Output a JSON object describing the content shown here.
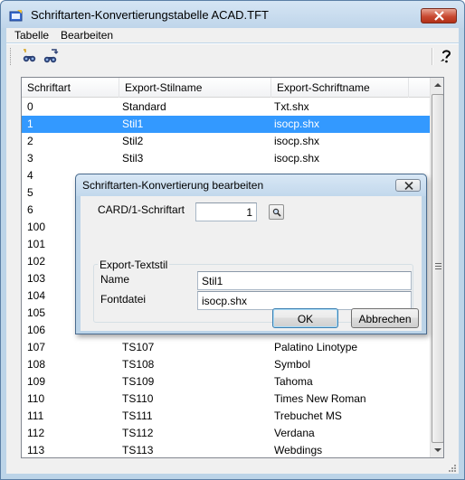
{
  "window": {
    "title": "Schriftarten-Konvertierungstabelle ACAD.TFT",
    "icon": "app-icon",
    "close_icon": "close-icon"
  },
  "menubar": {
    "items": [
      {
        "label": "Tabelle"
      },
      {
        "label": "Bearbeiten"
      }
    ]
  },
  "toolbar": {
    "buttons": [
      {
        "icon": "find-icon"
      },
      {
        "icon": "find-next-icon"
      },
      {
        "icon": "help-icon"
      }
    ]
  },
  "table": {
    "columns": [
      "Schriftart",
      "Export-Stilname",
      "Export-Schriftname"
    ],
    "rows": [
      {
        "font": "0",
        "style": "Standard",
        "file": "Txt.shx"
      },
      {
        "font": "1",
        "style": "Stil1",
        "file": "isocp.shx",
        "selected": true
      },
      {
        "font": "2",
        "style": "Stil2",
        "file": "isocp.shx"
      },
      {
        "font": "3",
        "style": "Stil3",
        "file": "isocp.shx"
      },
      {
        "font": "4",
        "style": "",
        "file": ""
      },
      {
        "font": "5",
        "style": "",
        "file": ""
      },
      {
        "font": "6",
        "style": "",
        "file": ""
      },
      {
        "font": "100",
        "style": "",
        "file": ""
      },
      {
        "font": "101",
        "style": "",
        "file": ""
      },
      {
        "font": "102",
        "style": "",
        "file": ""
      },
      {
        "font": "103",
        "style": "",
        "file": ""
      },
      {
        "font": "104",
        "style": "",
        "file": ""
      },
      {
        "font": "105",
        "style": "",
        "file": ""
      },
      {
        "font": "106",
        "style": "",
        "file": ""
      },
      {
        "font": "107",
        "style": "TS107",
        "file": "Palatino Linotype"
      },
      {
        "font": "108",
        "style": "TS108",
        "file": "Symbol"
      },
      {
        "font": "109",
        "style": "TS109",
        "file": "Tahoma"
      },
      {
        "font": "110",
        "style": "TS110",
        "file": "Times New Roman"
      },
      {
        "font": "111",
        "style": "TS111",
        "file": "Trebuchet MS"
      },
      {
        "font": "112",
        "style": "TS112",
        "file": "Verdana"
      },
      {
        "font": "113",
        "style": "TS113",
        "file": "Webdings"
      }
    ]
  },
  "dialog": {
    "title": "Schriftarten-Konvertierung bearbeiten",
    "card_label": "CARD/1-Schriftart",
    "card_value": "1",
    "group_label": "Export-Textstil",
    "name_label": "Name",
    "name_value": "Stil1",
    "fontfile_label": "Fontdatei",
    "fontfile_value": "isocp.shx",
    "ok_label": "OK",
    "cancel_label": "Abbrechen"
  },
  "colors": {
    "selection": "#3399ff",
    "titlebar": "#bcd4e8",
    "close_button": "#c94a32"
  }
}
